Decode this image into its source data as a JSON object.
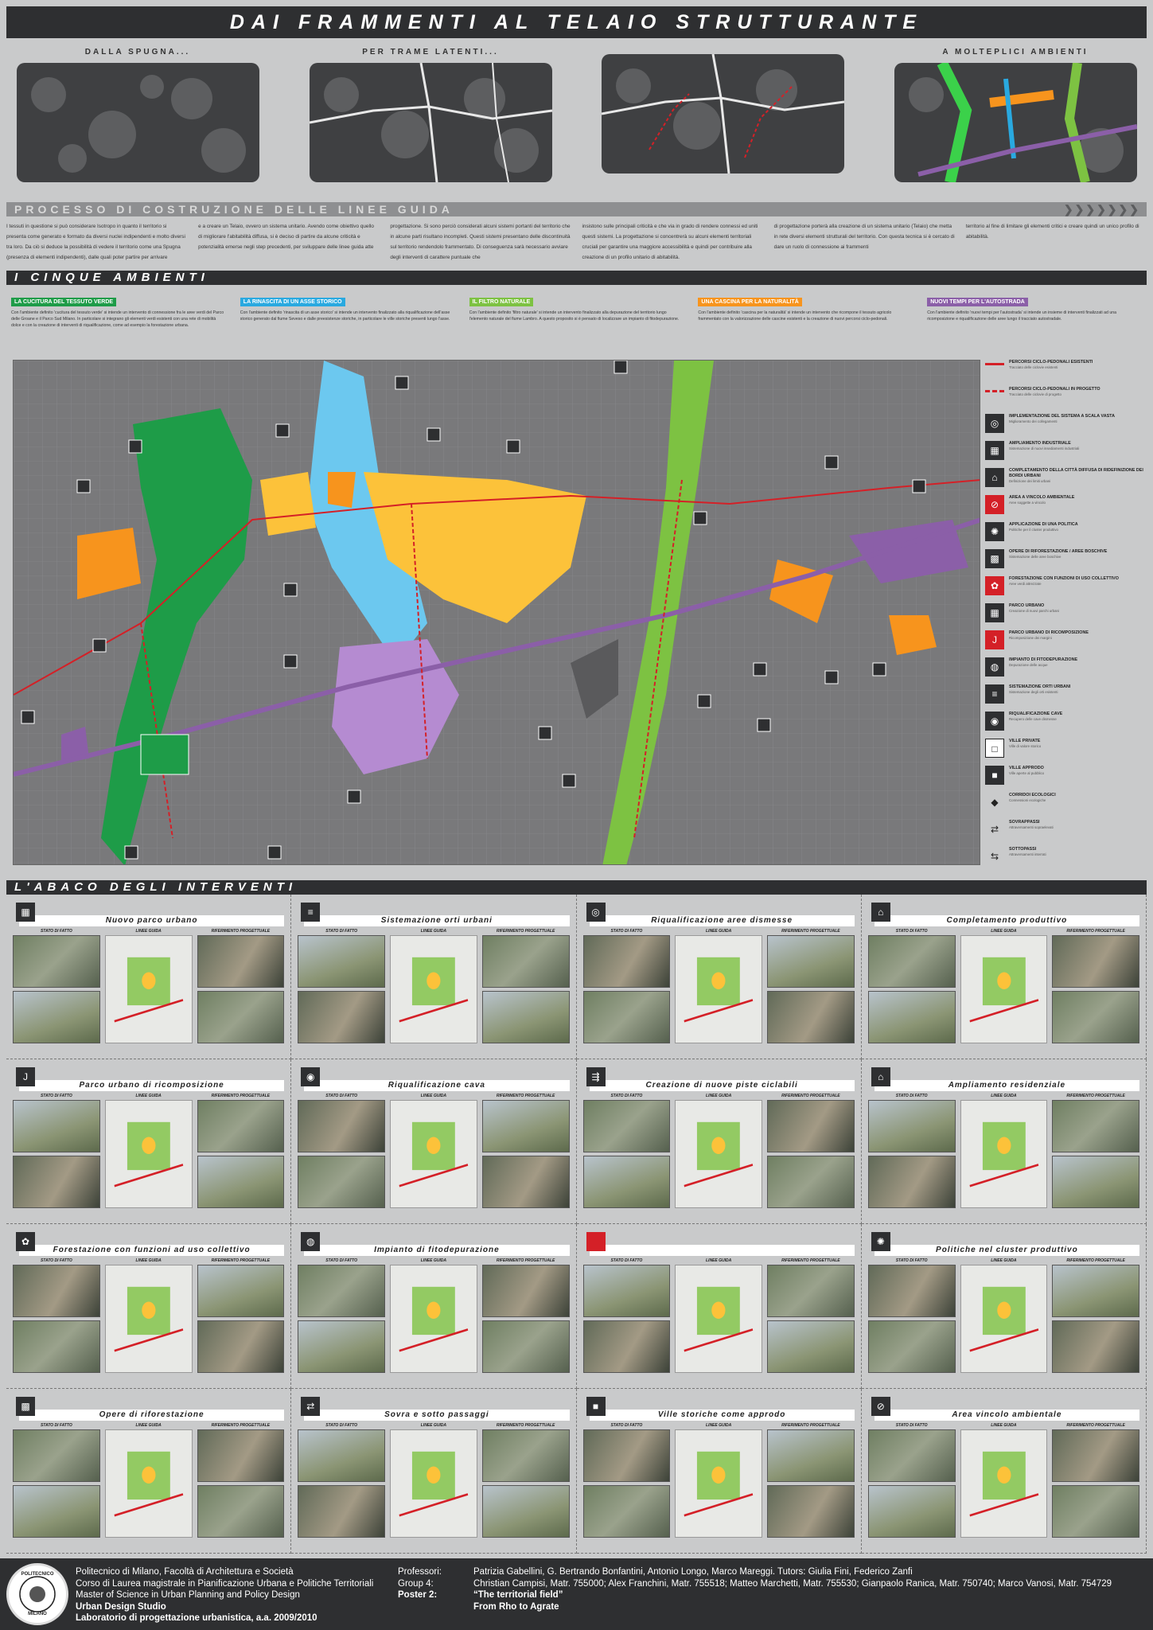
{
  "title": "DAI FRAMMENTI AL TELAIO STRUTTURANTE",
  "steps": [
    {
      "label": "DALLA SPUGNA..."
    },
    {
      "label": "PER TRAME LATENTI..."
    },
    {
      "label": ""
    },
    {
      "label": "A MOLTEPLICI AMBIENTI"
    }
  ],
  "process": {
    "heading": "PROCESSO DI COSTRUZIONE DELLE LINEE GUIDA",
    "paragraphs": [
      "I tessuti in questione si può considerare Isotropo in quanto il territorio si presenta come generato e formato da diversi nuclei indipendenti e molto diversi tra loro. Da ciò si deduce la possibilità di vedere il territorio come una Spugna (presenza di elementi indipendenti), dalle quali poter partire per arrivare",
      "e a creare un Telaio, ovvero un sistema unitario. Avendo come obiettivo quello di migliorare l'abitabilità diffusa, si è deciso di partire da alcune criticità e potenzialità emerse negli step precedenti, per sviluppare delle linee guida atte",
      "progettazione. Si sono perciò considerati alcuni sistemi portanti del territorio che in alcune parti risultano incompleti. Questi sistemi presentano delle discontinuità sul territorio rendendolo frammentato. Di conseguenza sarà necessario avviare degli interventi di carattere puntuale che",
      "insistono sulle principali criticità e che via in grado di rendere connessi ed uniti questi sistemi. La progettazione si concentrerà su alcuni elementi territoriali cruciali per garantire una maggiore accessibilità e quindi per contribuire alla creazione di un profilo unitario di abitabilità.",
      "di progettazione porterà alla creazione di un sistema unitario (Telaio) che metta in rete diversi elementi strutturali del territorio. Con questa tecnica si è cercato di dare un ruolo di connessione ai frammenti",
      "territorio al fine di limitare gli elementi critici e creare quindi un unico profilo di abitabilità."
    ]
  },
  "sections": {
    "cinque": "I CINQUE AMBIENTI",
    "abaco": "L'ABACO DEGLI INTERVENTI"
  },
  "themes": [
    {
      "tag": "LA CUCITURA DEL TESSUTO VERDE",
      "color": "#1e9c48",
      "text": "Con l'ambiente definito 'cucitura del tessuto verde' si intende un intervento di connessione fra le aree verdi del Parco delle Groane e il Parco Sud Milano. In particolare si integrano gli elementi verdi esistenti con una rete di mobilità dolce e con la creazione di interventi di riqualificazione, come ad esempio la forestazione urbana."
    },
    {
      "tag": "LA RINASCITA DI UN ASSE STORICO",
      "color": "#29a9e0",
      "text": "Con l'ambiente definito 'rinascita di un asse storico' si intende un intervento finalizzato alla riqualificazione dell'asse storico generato dal fiume Seveso e dalle preesistenze storiche, in particolare le ville storiche presenti lungo l'asse."
    },
    {
      "tag": "IL FILTRO NATURALE",
      "color": "#7dc242",
      "text": "Con l'ambiente definito 'filtro naturale' si intende un intervento finalizzato alla depurazione del territorio lungo l'elemento naturale del fiume Lambro. A questo proposito si è pensato di localizzare un impianto di fitodepurazione."
    },
    {
      "tag": "UNA CASCINA PER LA NATURALITÀ",
      "color": "#f7941d",
      "text": "Con l'ambiente definito 'cascina per la naturalità' si intende un intervento che ricompone il tessuto agricolo frammentato con la valorizzazione delle cascine esistenti e la creazione di nuovi percorsi ciclo-pedonali."
    },
    {
      "tag": "NUOVI TEMPI PER L'AUTOSTRADA",
      "color": "#8b5fa8",
      "text": "Con l'ambiente definito 'nuovi tempi per l'autostrada' si intende un insieme di interventi finalizzati ad una ricomposizione e riqualificazione delle aree lungo il tracciato autostradale."
    }
  ],
  "legend": [
    {
      "title": "PERCORSI CICLO-PEDONALI ESISTENTI",
      "desc": "Tracciato delle ciclovie esistenti",
      "icon": "line-solid"
    },
    {
      "title": "PERCORSI CICLO-PEDONALI IN PROGETTO",
      "desc": "Tracciato delle ciclovie di progetto",
      "icon": "line-dashed"
    },
    {
      "title": "IMPLEMENTAZIONE DEL SISTEMA A SCALA VASTA",
      "desc": "Miglioramento dei collegamenti",
      "icon": "◎"
    },
    {
      "title": "AMPLIAMENTO INDUSTRIALE",
      "desc": "Sistemazione di nuovi insediamenti industriali",
      "icon": "▦"
    },
    {
      "title": "COMPLETAMENTO DELLA CITTÀ DIFFUSA DI RIDEFINIZIONE DEI BORDI URBANI",
      "desc": "Definizione dei limiti urbani",
      "icon": "⌂"
    },
    {
      "title": "AREA A VINCOLO AMBIENTALE",
      "desc": "Aree soggette a vincolo",
      "icon": "⊘"
    },
    {
      "title": "APPLICAZIONE DI UNA POLITICA",
      "desc": "Politiche per il cluster produttivo",
      "icon": "✺"
    },
    {
      "title": "OPERE DI RIFORESTAZIONE / AREE BOSCHIVE",
      "desc": "Sistemazione delle aree boschive",
      "icon": "▩"
    },
    {
      "title": "FORESTAZIONE CON FUNZIONI DI USO COLLETTIVO",
      "desc": "Aree verdi attrezzate",
      "icon": "✿"
    },
    {
      "title": "PARCO URBANO",
      "desc": "Creazione di nuovi parchi urbani",
      "icon": "▦"
    },
    {
      "title": "PARCO URBANO DI RICOMPOSIZIONE",
      "desc": "Ricomposizione dei margini",
      "icon": "J"
    },
    {
      "title": "IMPIANTO DI FITODEPURAZIONE",
      "desc": "Depurazione delle acque",
      "icon": "◍"
    },
    {
      "title": "SISTEMAZIONE ORTI URBANI",
      "desc": "Sistemazione degli orti esistenti",
      "icon": "≡"
    },
    {
      "title": "RIQUALIFICAZIONE CAVE",
      "desc": "Recupero delle cave dismesse",
      "icon": "◉"
    },
    {
      "title": "VILLE PRIVATE",
      "desc": "Ville di valore storico",
      "icon": "□"
    },
    {
      "title": "VILLE APPRODO",
      "desc": "Ville aperte al pubblico",
      "icon": "■"
    },
    {
      "title": "CORRIDOI ECOLOGICI",
      "desc": "Connessioni ecologiche",
      "icon": "◆"
    },
    {
      "title": "SOVRAPPASSI",
      "desc": "Attraversamenti sopraelevati",
      "icon": "⇄"
    },
    {
      "title": "SOTTOPASSI",
      "desc": "Attraversamenti interrati",
      "icon": "⇆"
    }
  ],
  "abaco": {
    "sub_labels": [
      "STATO DI FATTO",
      "LINEE GUIDA",
      "RIFERIMENTO PROGETTUALE"
    ],
    "cards": [
      {
        "title": "Nuovo parco urbano",
        "icon": "▦"
      },
      {
        "title": "Sistemazione orti urbani",
        "icon": "≡"
      },
      {
        "title": "Riqualificazione aree dismesse",
        "icon": "◎"
      },
      {
        "title": "Completamento produttivo",
        "icon": "⌂"
      },
      {
        "title": "Parco urbano di ricomposizione",
        "icon": "J"
      },
      {
        "title": "Riqualificazione cava",
        "icon": "◉"
      },
      {
        "title": "Creazione di nuove piste ciclabili",
        "icon": "⇶"
      },
      {
        "title": "Ampliamento residenziale",
        "icon": "⌂"
      },
      {
        "title": "Forestazione con funzioni ad uso collettivo",
        "icon": "✿"
      },
      {
        "title": "Impianto di fitodepurazione",
        "icon": "◍"
      },
      {
        "title": "",
        "icon": ""
      },
      {
        "title": "Politiche nel cluster produttivo",
        "icon": "✺"
      },
      {
        "title": "Opere di riforestazione",
        "icon": "▩"
      },
      {
        "title": "Sovra e sotto passaggi",
        "icon": "⇄"
      },
      {
        "title": "Ville storiche come approdo",
        "icon": "■"
      },
      {
        "title": "Area vincolo ambientale",
        "icon": "⊘"
      }
    ]
  },
  "footer": {
    "left": [
      "Politecnico di Milano, Facoltà di Architettura e Società",
      "Corso di Laurea magistrale in Pianificazione Urbana e Politiche Territoriali",
      "Master of Science in Urban Planning and Policy Design",
      "Urban Design Studio",
      "Laboratorio di progettazione urbanistica, a.a. 2009/2010"
    ],
    "labels": [
      "Professori:",
      "Group 4:",
      "Poster 2:"
    ],
    "right": [
      "Patrizia Gabellini, G. Bertrando Bonfantini, Antonio Longo, Marco Mareggi. Tutors: Giulia Fini, Federico Zanfi",
      "Christian Campisi, Matr. 755000; Alex Franchini, Matr. 755518; Matteo Marchetti, Matr. 755530; Gianpaolo Ranica, Matr. 750740; Marco Vanosi, Matr. 754729",
      "“The territorial field”",
      "From Rho to Agrate"
    ],
    "logo_top": "POLITECNICO",
    "logo_bottom": "MILANO"
  },
  "colors": {
    "green": "#1e9c48",
    "light_green": "#7dc242",
    "blue": "#29a9e0",
    "orange": "#f7941d",
    "yellow": "#fcc23a",
    "purple": "#8b5fa8",
    "red": "#d42027"
  }
}
